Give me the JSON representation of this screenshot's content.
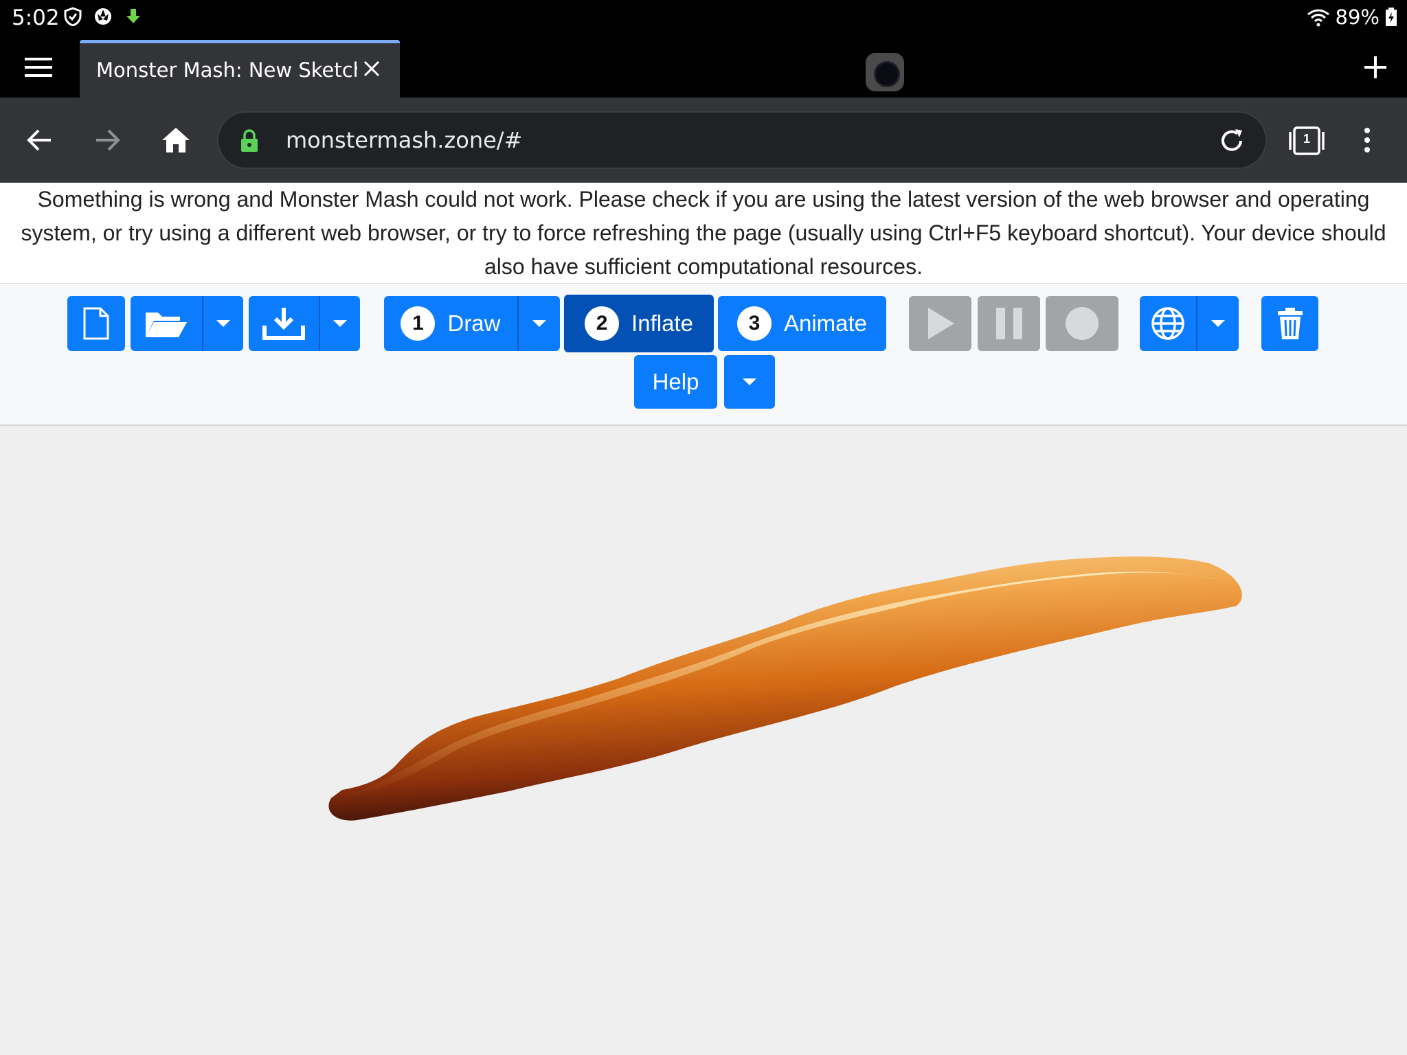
{
  "status_bar": {
    "time": "5:02",
    "battery": "89%",
    "icons": [
      "shield-icon",
      "aperture-icon",
      "download-arrow-icon",
      "wifi-icon",
      "battery-icon"
    ]
  },
  "browser": {
    "tab_title": "Monster Mash: New Sketch-",
    "url": "monstermash.zone/#",
    "tab_count": "1",
    "tab_accent": "#7cacf8",
    "lock_color": "#5bd35b"
  },
  "error": {
    "message": "Something is wrong and Monster Mash could not work. Please check if you are using the latest version of the web browser and operating system, or try using a different web browser, or try to force refreshing the page (usually using Ctrl+F5 keyboard shortcut). Your device should also have sufficient computational resources."
  },
  "app_toolbar": {
    "accent": "#0b7cfe",
    "active_color": "#0451b6",
    "disabled_color": "#a2a5a8",
    "steps": [
      {
        "num": "1",
        "label": "Draw"
      },
      {
        "num": "2",
        "label": "Inflate"
      },
      {
        "num": "3",
        "label": "Animate"
      }
    ],
    "help_label": "Help"
  }
}
